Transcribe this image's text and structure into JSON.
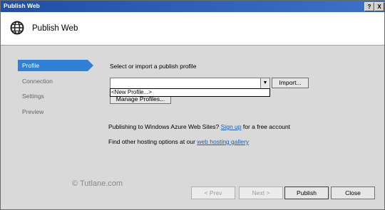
{
  "window": {
    "title": "Publish Web",
    "help_label": "?",
    "close_label": "X"
  },
  "header": {
    "title": "Publish Web",
    "icon": "globe-icon"
  },
  "nav": {
    "items": [
      {
        "label": "Profile",
        "active": true
      },
      {
        "label": "Connection"
      },
      {
        "label": "Settings"
      },
      {
        "label": "Preview"
      }
    ]
  },
  "profile": {
    "prompt": "Select or import a publish profile",
    "combo_value": "",
    "dropdown_item": "<New Profile...>",
    "import_label": "Import...",
    "manage_label": "Manage Profiles..."
  },
  "info": {
    "azure_text": "Publishing to Windows Azure Web Sites?",
    "azure_link": "Sign up",
    "azure_suffix": "for a free account",
    "hosting_text": "Find other hosting options at our",
    "hosting_link": "web hosting gallery"
  },
  "watermark": "© Tutlane.com",
  "footer": {
    "prev_label": "< Prev",
    "next_label": "Next >",
    "publish_label": "Publish",
    "close_label": "Close"
  }
}
